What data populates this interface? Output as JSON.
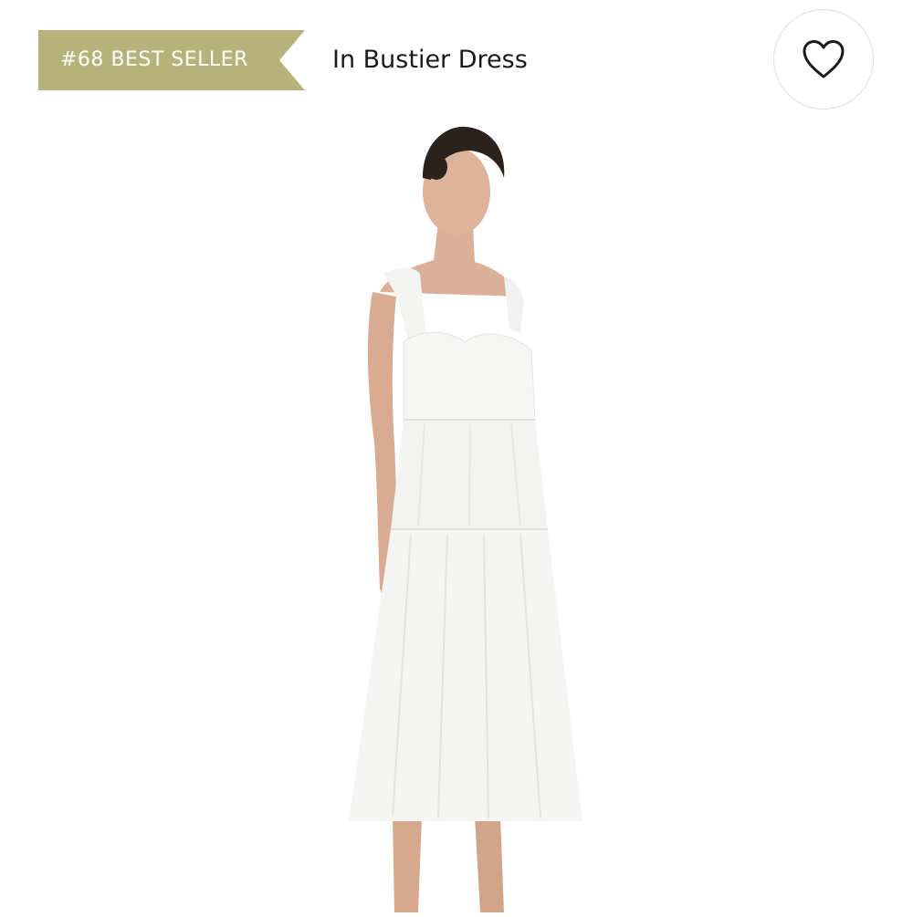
{
  "badge": {
    "label": "#68 BEST SELLER",
    "color": "#b6b27a"
  },
  "product": {
    "title": "In Bustier Dress"
  },
  "favorite": {
    "icon": "heart-outline-icon"
  },
  "image": {
    "subject": "product-photo"
  }
}
